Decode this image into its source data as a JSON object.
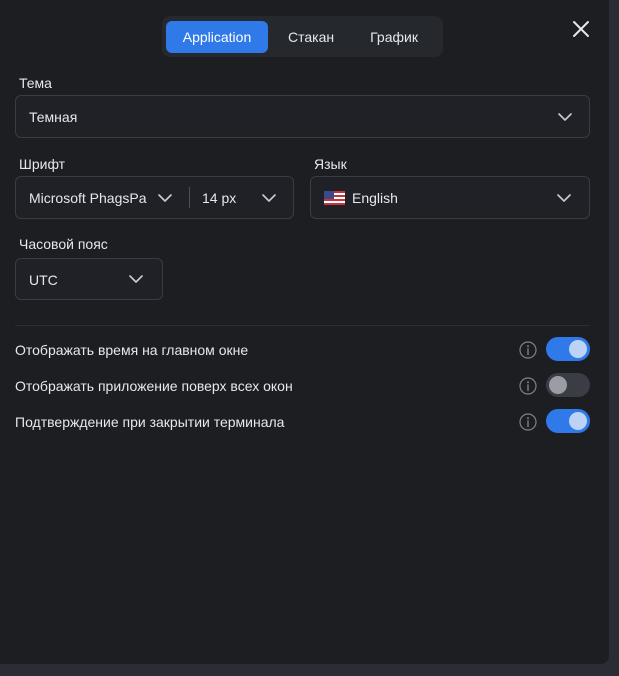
{
  "tabs": [
    {
      "label": "Application",
      "active": true
    },
    {
      "label": "Стакан",
      "active": false
    },
    {
      "label": "График",
      "active": false
    }
  ],
  "theme": {
    "label": "Тема",
    "value": "Темная"
  },
  "font": {
    "label": "Шрифт",
    "family": "Microsoft PhagsPa",
    "size": "14 px"
  },
  "language": {
    "label": "Язык",
    "value": "English",
    "flag_icon": "us-flag-icon"
  },
  "timezone": {
    "label": "Часовой пояс",
    "value": "UTC"
  },
  "options": [
    {
      "label": "Отображать время на главном окне",
      "enabled": true
    },
    {
      "label": "Отображать приложение поверх всех окон",
      "enabled": false
    },
    {
      "label": "Подтверждение при закрытии терминала",
      "enabled": true
    }
  ],
  "colors": {
    "accent": "#2f79e9",
    "background": "#1c1e22"
  }
}
